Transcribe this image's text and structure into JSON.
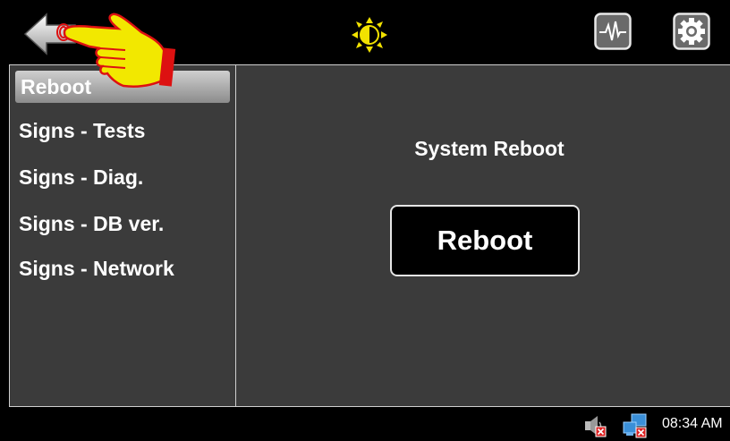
{
  "toolbar": {
    "back_icon": "back-arrow-icon",
    "brightness_icon": "brightness-icon",
    "waveform_icon": "waveform-icon",
    "settings_icon": "gear-icon",
    "accent_color": "#f2e200"
  },
  "sidebar": {
    "items": [
      {
        "label": "Reboot",
        "selected": true
      },
      {
        "label": "Signs - Tests"
      },
      {
        "label": "Signs - Diag."
      },
      {
        "label": "Signs - DB ver."
      },
      {
        "label": "Signs - Network"
      }
    ]
  },
  "main": {
    "title": "System Reboot",
    "button_label": "Reboot"
  },
  "statusbar": {
    "volume_icon": "speaker-muted-icon",
    "network_icon": "network-disconnected-icon",
    "clock": "08:34 AM"
  }
}
